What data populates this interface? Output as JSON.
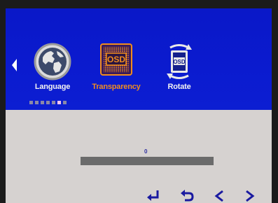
{
  "menu": {
    "items": [
      {
        "label": "Language",
        "icon": "globe-icon",
        "selected": false
      },
      {
        "label": "Transparency",
        "icon": "osd-transparency-icon",
        "icon_text": "OSD",
        "selected": true
      },
      {
        "label": "Rotate",
        "icon": "osd-rotate-icon",
        "icon_text": "OSD",
        "selected": false
      }
    ]
  },
  "pagination": {
    "count": 7,
    "active_index": 5
  },
  "slider": {
    "value": "0",
    "level": 0
  },
  "footer": {
    "icons": [
      "enter-icon",
      "back-icon",
      "left-arrow-icon",
      "right-arrow-icon"
    ]
  },
  "colors": {
    "panel": "#0b1bcf",
    "selected": "#f08c1e",
    "track": "#6b6b6b",
    "background": "#d6d2d0"
  }
}
